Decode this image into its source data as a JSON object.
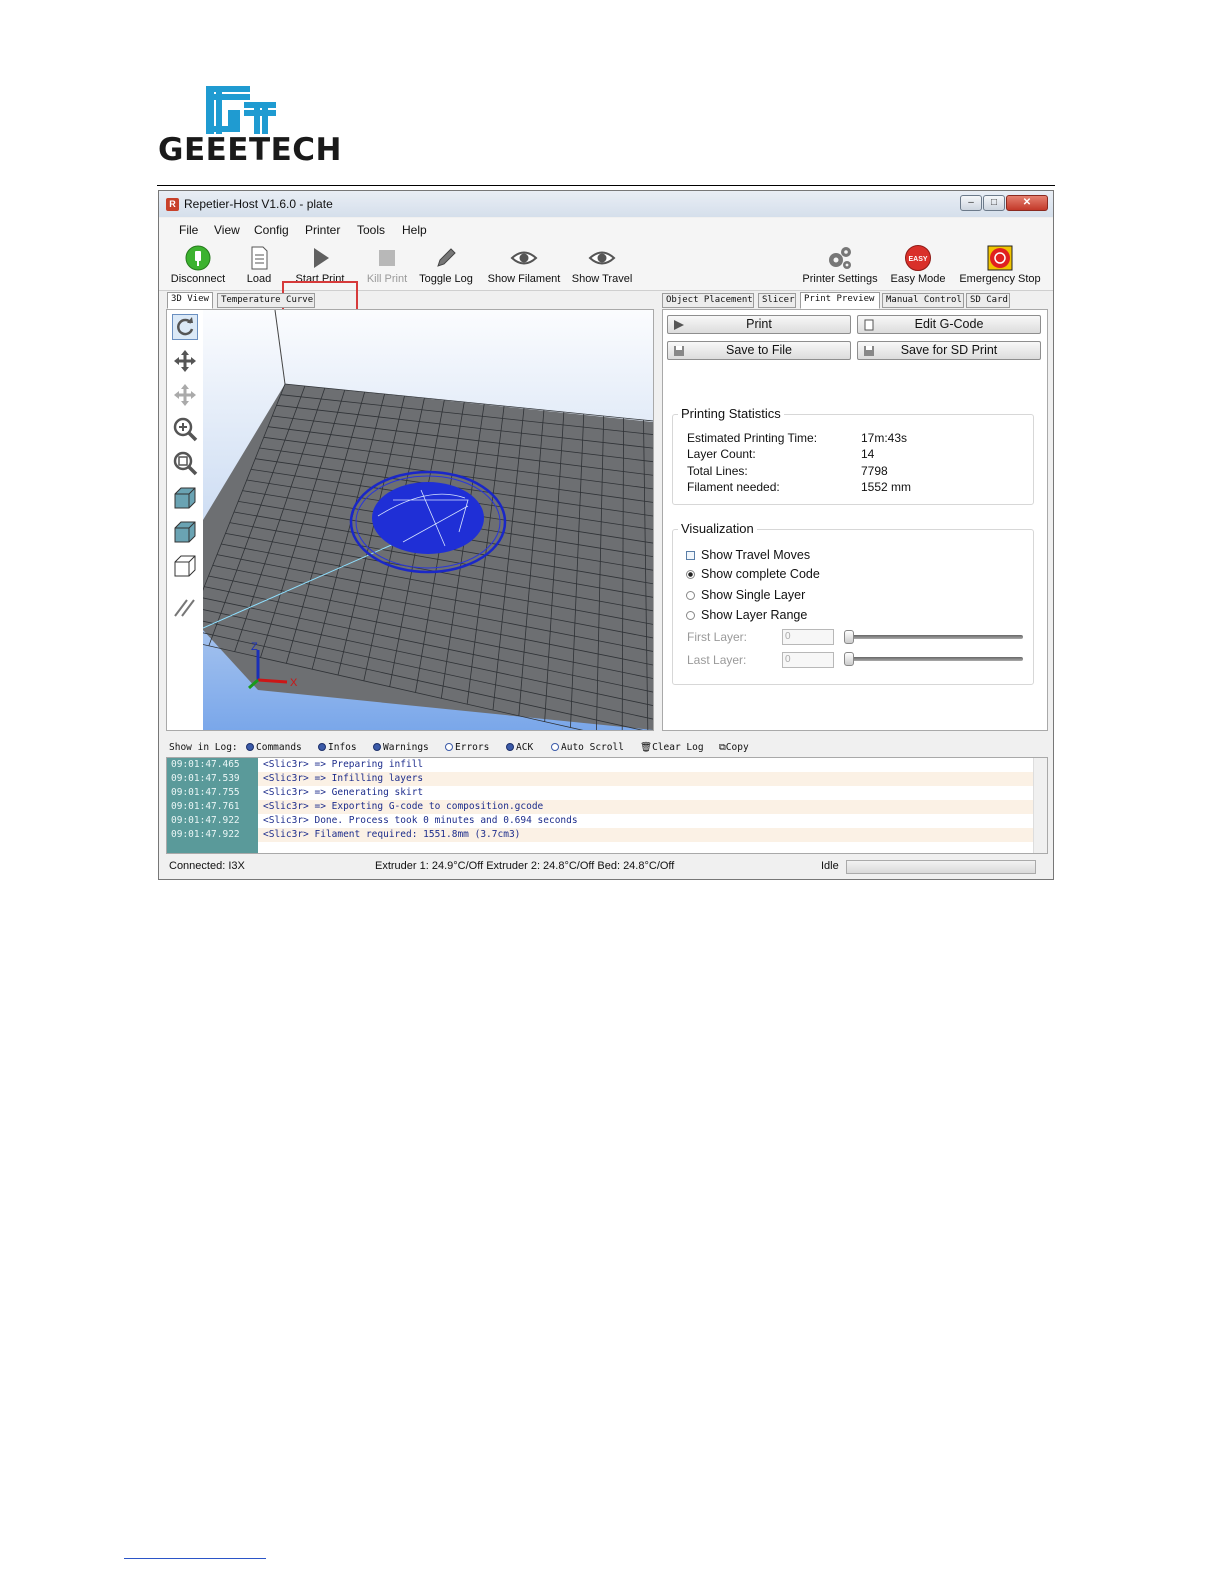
{
  "brand": {
    "logo_text": "GEEETECH"
  },
  "window": {
    "title": "Repetier-Host V1.6.0 - plate",
    "app_icon": "R"
  },
  "menu": [
    "File",
    "View",
    "Config",
    "Printer",
    "Tools",
    "Help"
  ],
  "toolbar": {
    "disconnect": "Disconnect",
    "load": "Load",
    "start_print": "Start Print",
    "kill_print": "Kill Print",
    "toggle_log": "Toggle Log",
    "show_filament": "Show Filament",
    "show_travel": "Show Travel",
    "printer_settings": "Printer Settings",
    "easy_mode": "Easy Mode",
    "easy_badge": "EASY",
    "emergency_stop": "Emergency Stop"
  },
  "left_tabs": [
    "3D View",
    "Temperature Curve"
  ],
  "right_tabs": [
    "Object Placement",
    "Slicer",
    "Print Preview",
    "Manual Control",
    "SD Card"
  ],
  "preview": {
    "print_button": "Print",
    "edit_gcode_button": "Edit G-Code",
    "save_to_file_button": "Save to File",
    "save_sd_button": "Save for SD Print",
    "stats_title": "Printing Statistics",
    "stats": [
      {
        "label": "Estimated Printing Time:",
        "value": "17m:43s"
      },
      {
        "label": "Layer Count:",
        "value": "14"
      },
      {
        "label": "Total Lines:",
        "value": "7798"
      },
      {
        "label": "Filament needed:",
        "value": "1552 mm"
      }
    ],
    "viz_title": "Visualization",
    "show_travel_moves": "Show Travel Moves",
    "show_complete_code": "Show complete Code",
    "show_single_layer": "Show Single Layer",
    "show_layer_range": "Show Layer Range",
    "first_layer_label": "First Layer:",
    "last_layer_label": "Last Layer:",
    "first_layer_value": "0",
    "last_layer_value": "0"
  },
  "axes": {
    "z": "Z",
    "x": "X"
  },
  "log_filters": {
    "show_in_log": "Show in Log:",
    "commands": "Commands",
    "infos": "Infos",
    "warnings": "Warnings",
    "errors": "Errors",
    "ack": "ACK",
    "auto_scroll": "Auto Scroll",
    "clear_log": "Clear Log",
    "copy": "Copy"
  },
  "log": [
    {
      "time": "09:01:47.465",
      "msg": "<Slic3r> => Preparing infill"
    },
    {
      "time": "09:01:47.539",
      "msg": "<Slic3r> => Infilling layers"
    },
    {
      "time": "09:01:47.755",
      "msg": "<Slic3r> => Generating skirt"
    },
    {
      "time": "09:01:47.761",
      "msg": "<Slic3r> => Exporting G-code to composition.gcode"
    },
    {
      "time": "09:01:47.922",
      "msg": "<Slic3r> Done. Process took 0 minutes and 0.694 seconds"
    },
    {
      "time": "09:01:47.922",
      "msg": "<Slic3r> Filament required: 1551.8mm (3.7cm3)"
    }
  ],
  "status": {
    "connected": "Connected: I3X",
    "temps": "Extruder 1: 24.9°C/Off Extruder 2: 24.8°C/Off Bed: 24.8°C/Off",
    "state": "Idle"
  },
  "colors": {
    "accent_highlight": "#d63a3a",
    "log_time_bg": "#5a9a9a",
    "model_blue": "#1f2fd6"
  }
}
